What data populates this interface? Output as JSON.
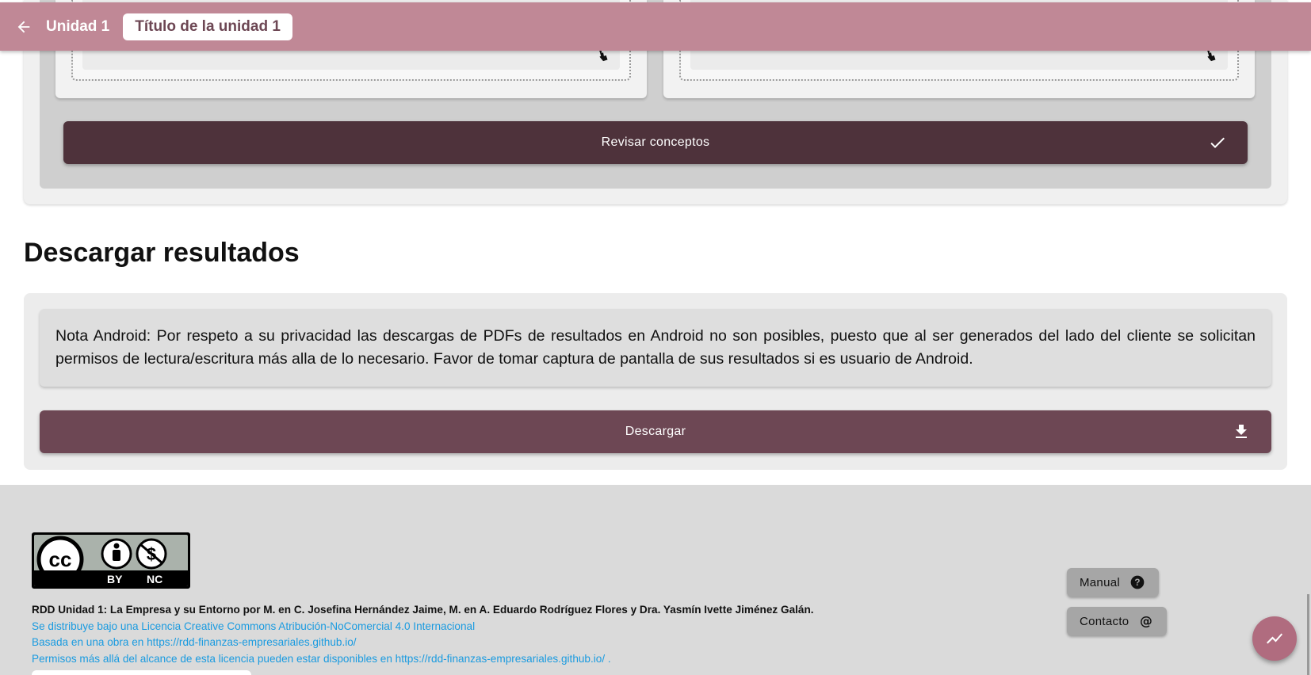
{
  "header": {
    "unit_label": "Unidad 1",
    "unit_title": "Título de la unidad 1",
    "back_icon": "arrow-back-icon"
  },
  "activity": {
    "review_button_label": "Revisar conceptos",
    "review_icon": "check-icon",
    "drag_icon": "drag-hand-icon"
  },
  "download": {
    "title": "Descargar resultados",
    "note": "Nota Android: Por respeto a su privacidad las descargas de PDFs de resultados en Android no son posibles, puesto que al ser generados del lado del cliente se solicitan permisos de lectura/escritura más alla de lo necesario. Favor de tomar captura de pantalla de sus resultados si es usuario de Android.",
    "button_label": "Descargar",
    "button_icon": "download-icon"
  },
  "footer": {
    "license_badge": {
      "by": "BY",
      "nc": "NC"
    },
    "author_line": "RDD Unidad 1: La Empresa y su Entorno por M. en C. Josefina Hernández Jaime, M. en A. Eduardo Rodríguez Flores y Dra. Yasmín Ivette Jiménez Galán.",
    "license_link": "Se distribuye bajo una Licencia Creative Commons Atribución-NoComercial 4.0 Internacional",
    "based_on": "Basada en una obra en https://rdd-finanzas-empresariales.github.io/",
    "permissions": "Permisos más allá del alcance de esta licencia pueden estar disponibles en https://rdd-finanzas-empresariales.github.io/ .",
    "manual_label": "Manual",
    "contact_label": "Contacto"
  },
  "colors": {
    "appbar": "#c08896",
    "review_button": "#4e323b",
    "download_button": "#6d4754",
    "fab": "#b06c7f",
    "link": "#1a9be0"
  }
}
